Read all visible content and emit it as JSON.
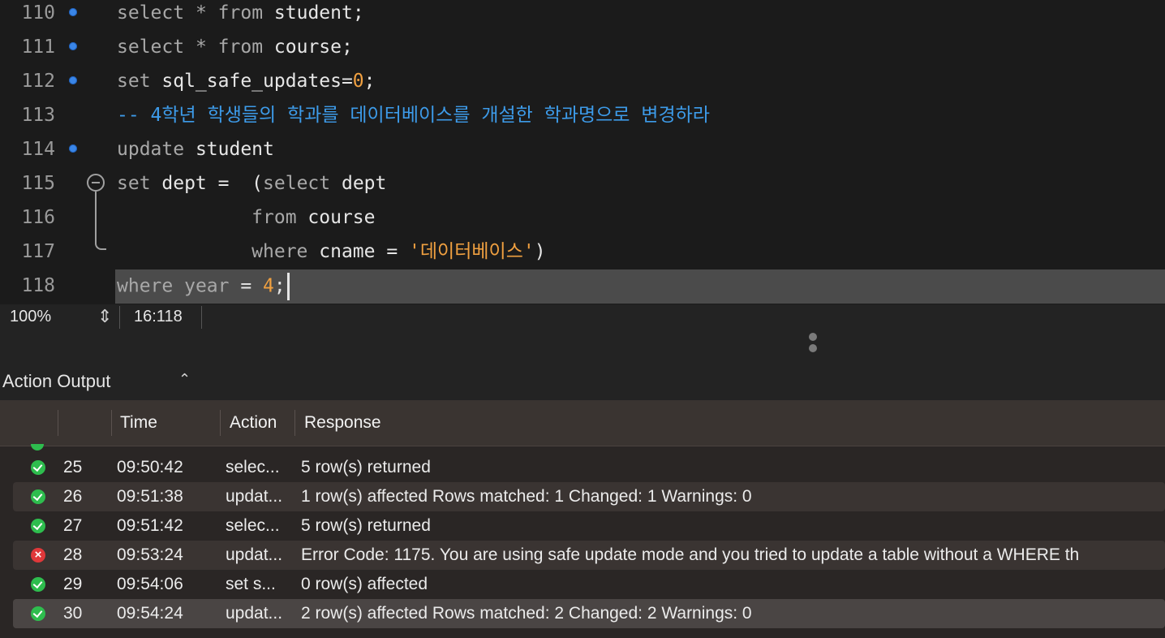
{
  "editor": {
    "lines": [
      {
        "num": "110",
        "parts": [
          [
            "kw",
            "select"
          ],
          [
            "plain",
            " "
          ],
          [
            "kw",
            "*"
          ],
          [
            "plain",
            " "
          ],
          [
            "kw",
            "from"
          ],
          [
            "plain",
            " student;"
          ]
        ],
        "dot": true
      },
      {
        "num": "111",
        "parts": [
          [
            "kw",
            "select"
          ],
          [
            "plain",
            " "
          ],
          [
            "kw",
            "*"
          ],
          [
            "plain",
            " "
          ],
          [
            "kw",
            "from"
          ],
          [
            "plain",
            " course;"
          ]
        ],
        "dot": true
      },
      {
        "num": "112",
        "parts": [
          [
            "kw",
            "set"
          ],
          [
            "plain",
            " sql_safe_updates="
          ],
          [
            "num",
            "0"
          ],
          [
            "plain",
            ";"
          ]
        ],
        "dot": true
      },
      {
        "num": "113",
        "parts": [
          [
            "cmt",
            "-- 4학년 학생들의 학과를 데이터베이스를 개설한 학과명으로 변경하라"
          ]
        ],
        "dot": false
      },
      {
        "num": "114",
        "parts": [
          [
            "kw",
            "update"
          ],
          [
            "plain",
            " student"
          ]
        ],
        "dot": true
      },
      {
        "num": "115",
        "parts": [
          [
            "kw",
            "set"
          ],
          [
            "plain",
            " dept =  ("
          ],
          [
            "kw",
            "select"
          ],
          [
            "plain",
            " dept"
          ]
        ],
        "dot": false
      },
      {
        "num": "116",
        "parts": [
          [
            "plain",
            "            "
          ],
          [
            "kw",
            "from"
          ],
          [
            "plain",
            " course"
          ]
        ],
        "dot": false
      },
      {
        "num": "117",
        "parts": [
          [
            "plain",
            "            "
          ],
          [
            "kw",
            "where"
          ],
          [
            "plain",
            " cname = "
          ],
          [
            "str",
            "'데이터베이스'"
          ],
          [
            "plain",
            ")"
          ]
        ],
        "dot": false
      },
      {
        "num": "118",
        "parts": [
          [
            "kw",
            "where"
          ],
          [
            "plain",
            " "
          ],
          [
            "kw",
            "year"
          ],
          [
            "plain",
            " = "
          ],
          [
            "num",
            "4"
          ],
          [
            "plain",
            ";"
          ]
        ],
        "dot": false
      }
    ]
  },
  "statusbar": {
    "zoom": "100%",
    "cursor_position": "16:118"
  },
  "output": {
    "title": "Action Output",
    "columns": [
      "Time",
      "Action",
      "Response"
    ],
    "rows": [
      {
        "status": "ok",
        "id": "25",
        "time": "09:50:42",
        "action": "selec...",
        "response": "5 row(s) returned"
      },
      {
        "status": "ok",
        "id": "26",
        "time": "09:51:38",
        "action": "updat...",
        "response": "1 row(s) affected Rows matched: 1  Changed: 1  Warnings: 0"
      },
      {
        "status": "ok",
        "id": "27",
        "time": "09:51:42",
        "action": "selec...",
        "response": "5 row(s) returned"
      },
      {
        "status": "error",
        "id": "28",
        "time": "09:53:24",
        "action": "updat...",
        "response": "Error Code: 1175. You are using safe update mode and you tried to update a table without a WHERE th"
      },
      {
        "status": "ok",
        "id": "29",
        "time": "09:54:06",
        "action": "set s...",
        "response": "0 row(s) affected"
      },
      {
        "status": "ok",
        "id": "30",
        "time": "09:54:24",
        "action": "updat...",
        "response": "2 row(s) affected Rows matched: 2  Changed: 2  Warnings: 0"
      }
    ]
  }
}
